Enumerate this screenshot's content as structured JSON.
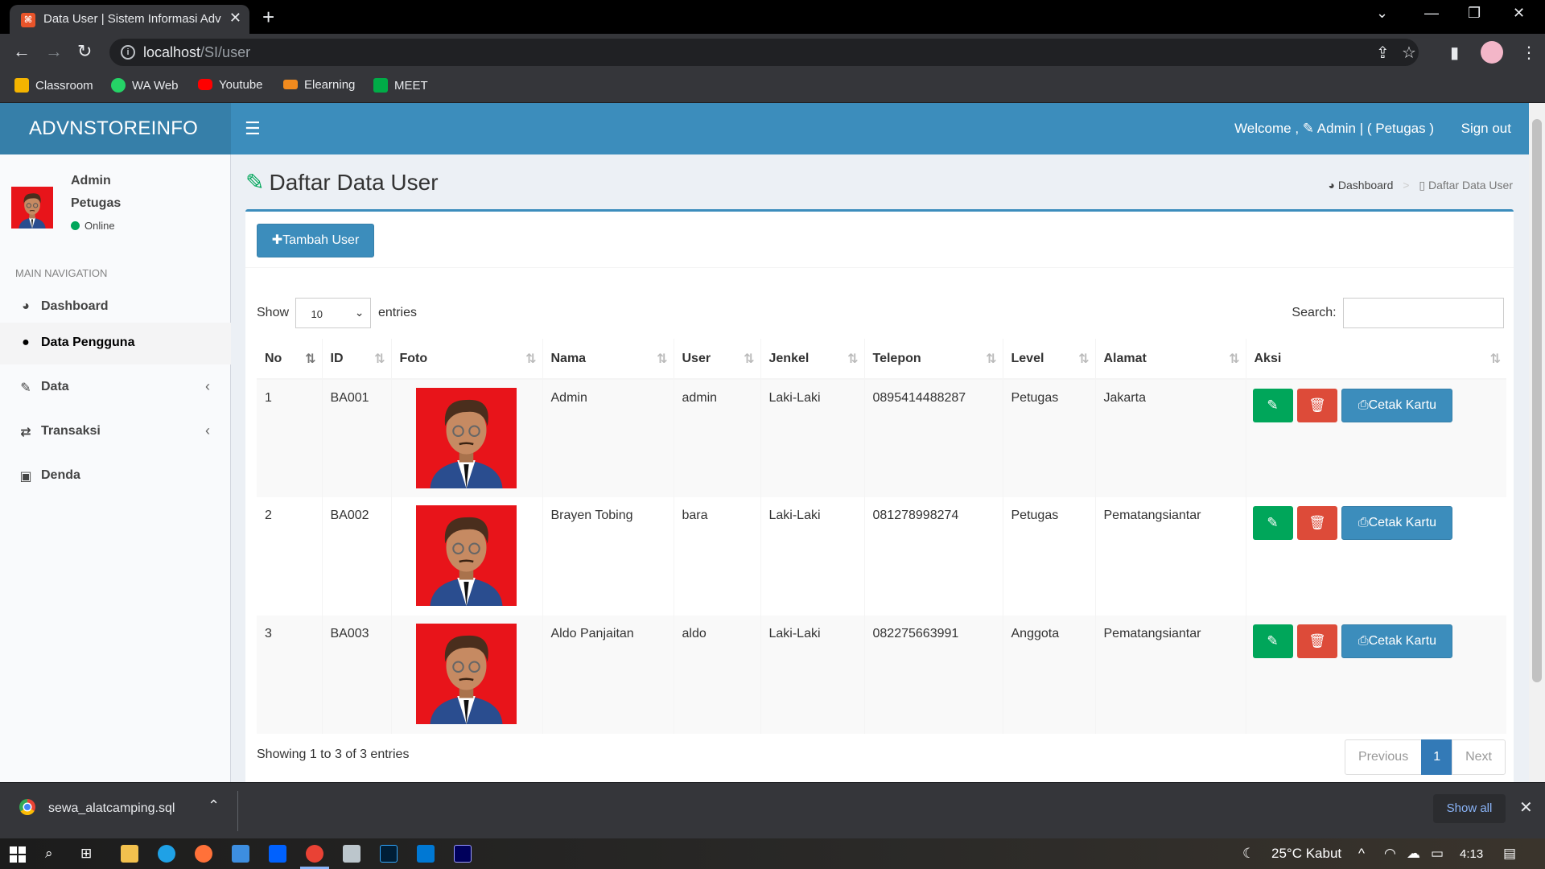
{
  "browser": {
    "tab_title": "Data User | Sistem Informasi Adv",
    "url_host": "localhost",
    "url_path": "/SI/user",
    "bookmarks": [
      {
        "label": "Classroom",
        "color": "#f4b400"
      },
      {
        "label": "WA Web",
        "color": "#25d366"
      },
      {
        "label": "Youtube",
        "color": "#ff0000"
      },
      {
        "label": "Elearning",
        "color": "#f28b1e"
      },
      {
        "label": "MEET",
        "color": "#00ac47"
      }
    ]
  },
  "app": {
    "logo": "ADVNSTOREINFO",
    "welcome": "Welcome , ✎ Admin | ( Petugas )",
    "signout": "Sign out",
    "accent": "#3c8dbc"
  },
  "sidebar": {
    "user_name": "Admin",
    "user_role": "Petugas",
    "status": "Online",
    "nav_header": "MAIN NAVIGATION",
    "items": [
      {
        "label": "Dashboard",
        "icon": "dashboard-icon"
      },
      {
        "label": "Data Pengguna",
        "icon": "user-icon"
      },
      {
        "label": "Data",
        "icon": "edit-icon"
      },
      {
        "label": "Transaksi",
        "icon": "exchange-icon"
      },
      {
        "label": "Denda",
        "icon": "money-icon"
      }
    ]
  },
  "content": {
    "title": "Daftar Data User",
    "breadcrumb_home": "Dashboard",
    "breadcrumb_current": "Daftar Data User",
    "add_button": "Tambah User",
    "show_label": "Show",
    "entries_label": "entries",
    "page_length": "10",
    "search_label": "Search:",
    "info": "Showing 1 to 3 of 3 entries",
    "pager": {
      "previous": "Previous",
      "current": "1",
      "next": "Next"
    }
  },
  "table": {
    "columns": [
      "No",
      "ID",
      "Foto",
      "Nama",
      "User",
      "Jenkel",
      "Telepon",
      "Level",
      "Alamat",
      "Aksi"
    ],
    "print_label": "Cetak Kartu",
    "rows": [
      {
        "no": "1",
        "id": "BA001",
        "nama": "Admin",
        "user": "admin",
        "jenkel": "Laki-Laki",
        "telepon": "0895414488287",
        "level": "Petugas",
        "alamat": "Jakarta"
      },
      {
        "no": "2",
        "id": "BA002",
        "nama": "Brayen Tobing",
        "user": "bara",
        "jenkel": "Laki-Laki",
        "telepon": "081278998274",
        "level": "Petugas",
        "alamat": "Pematangsiantar"
      },
      {
        "no": "3",
        "id": "BA003",
        "nama": "Aldo Panjaitan",
        "user": "aldo",
        "jenkel": "Laki-Laki",
        "telepon": "082275663991",
        "level": "Anggota",
        "alamat": "Pematangsiantar"
      }
    ]
  },
  "download": {
    "file": "sewa_alatcamping.sql",
    "show_all": "Show all"
  },
  "taskbar": {
    "weather": "25°C  Kabut",
    "time": "4:13"
  }
}
